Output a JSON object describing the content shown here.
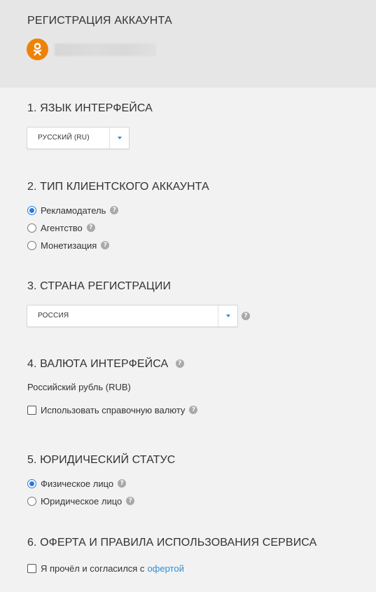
{
  "header": {
    "title": "РЕГИСТРАЦИЯ АККАУНТА",
    "logo_icon": "odnoklassniki-icon",
    "logo_color": "#ee8208"
  },
  "sections": {
    "language": {
      "title": "1. ЯЗЫК ИНТЕРФЕЙСА",
      "selected": "РУССКИЙ (RU)"
    },
    "account_type": {
      "title": "2. ТИП КЛИЕНТСКОГО АККАУНТА",
      "options": [
        {
          "label": "Рекламодатель",
          "checked": true
        },
        {
          "label": "Агентство",
          "checked": false
        },
        {
          "label": "Монетизация",
          "checked": false
        }
      ]
    },
    "country": {
      "title": "3. СТРАНА РЕГИСТРАЦИИ",
      "selected": "РОССИЯ"
    },
    "currency": {
      "title": "4. ВАЛЮТА ИНТЕРФЕЙСА",
      "value": "Российский рубль (RUB)",
      "reference_checkbox_label": "Использовать справочную валюту",
      "reference_checked": false
    },
    "legal_status": {
      "title": "5. ЮРИДИЧЕСКИЙ СТАТУС",
      "options": [
        {
          "label": "Физическое лицо",
          "checked": true
        },
        {
          "label": "Юридическое лицо",
          "checked": false
        }
      ]
    },
    "offer": {
      "title": "6. ОФЕРТА И ПРАВИЛА ИСПОЛЬЗОВАНИЯ СЕРВИСА",
      "checkbox_label": "Я прочёл и согласился с",
      "link_label": "офертой",
      "checked": false
    }
  },
  "colors": {
    "accent": "#2d8fd8",
    "radio_checked": "#2a7ad6",
    "help_icon": "#a9a9a9"
  },
  "help_glyph": "?"
}
